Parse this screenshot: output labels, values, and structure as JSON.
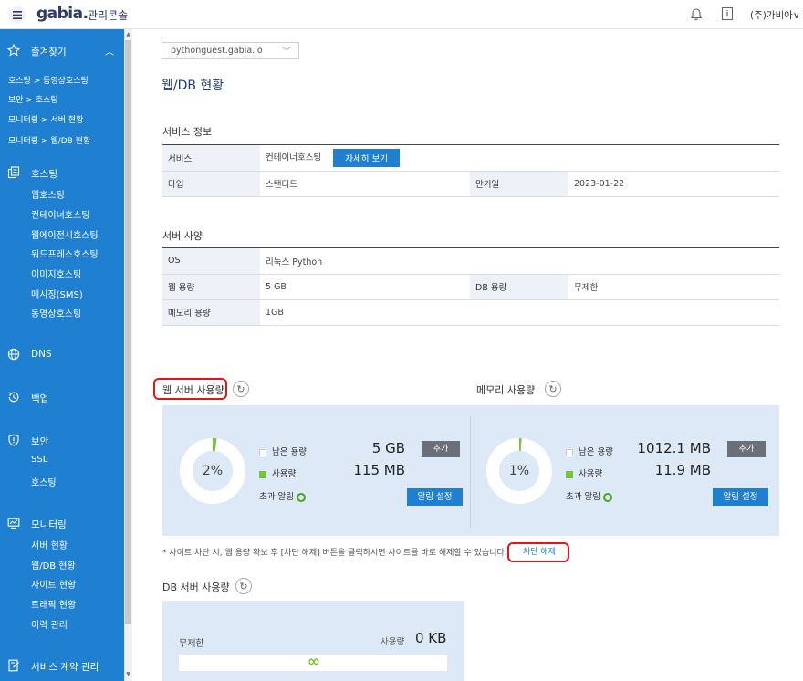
{
  "header": {
    "brand": "gabia.",
    "brand_sub": "관리콘솔",
    "user": "(주)가비아",
    "user_chevron": "∨"
  },
  "sidebar": {
    "favorites": {
      "label": "즐겨찾기",
      "items": [
        "호스팅 > 동영상호스팅",
        "보안 > 호스팅",
        "모니터링 > 서버 현황",
        "모니터링 > 웹/DB 현황"
      ]
    },
    "hosting": {
      "label": "호스팅",
      "items": [
        "웹호스팅",
        "컨테이너호스팅",
        "웹에이전시호스팅",
        "워드프레스호스팅",
        "이미지호스팅",
        "메시징(SMS)",
        "동영상호스팅"
      ]
    },
    "dns": {
      "label": "DNS"
    },
    "backup": {
      "label": "백업"
    },
    "security": {
      "label": "보안",
      "items": [
        "SSL",
        "호스팅"
      ]
    },
    "monitoring": {
      "label": "모니터링",
      "items": [
        "서버 현황",
        "웹/DB 현황",
        "사이트 현황",
        "트래픽 현황",
        "이력 관리"
      ]
    },
    "contract": {
      "label": "서비스 계약 관리"
    }
  },
  "main": {
    "domain_select": "pythonguest.gabia.io",
    "page_title": "웹/DB 현황",
    "service_info": {
      "title": "서비스 정보",
      "service_label": "서비스",
      "service_value": "컨테이너호스팅",
      "detail_button": "자세히 보기",
      "type_label": "타입",
      "type_value": "스탠더드",
      "expiry_label": "만기일",
      "expiry_value": "2023-01-22"
    },
    "server_spec": {
      "title": "서버 사양",
      "os_label": "OS",
      "os_value": "리눅스 Python",
      "web_cap_label": "웹 용량",
      "web_cap_value": "5 GB",
      "db_cap_label": "DB 용량",
      "db_cap_value": "무제한",
      "mem_cap_label": "메모리 용량",
      "mem_cap_value": "1GB"
    },
    "web_usage": {
      "title": "웹 서버 사용량",
      "percent": "2%",
      "fraction": 0.02,
      "remaining_label": "남은 용량",
      "remaining_value": "5 GB",
      "used_label": "사용량",
      "used_value": "115 MB",
      "alert_label": "초과 알림",
      "add_button": "추가",
      "alert_button": "알림 설정"
    },
    "memory_usage": {
      "title": "메모리 사용량",
      "percent": "1%",
      "fraction": 0.01,
      "remaining_label": "남은 용량",
      "remaining_value": "1012.1 MB",
      "used_label": "사용량",
      "used_value": "11.9 MB",
      "alert_label": "초과 알림",
      "add_button": "추가",
      "alert_button": "알림 설정"
    },
    "notice": "* 사이트 차단 시, 웹 용량 확보 후 [차단 해제] 버튼을 클릭하시면 사이트를 바로 해제할 수 있습니다.",
    "unblock_button": "차단 해제",
    "db_usage": {
      "title": "DB 서버 사용량",
      "limit": "무제한",
      "used_label": "사용량",
      "used_value": "0 KB",
      "infinity": "∞"
    }
  },
  "colors": {
    "primary": "#1f7fd1",
    "panel": "#dde9f7",
    "accent_green": "#7cc03c",
    "highlight_red": "#e5141b"
  }
}
